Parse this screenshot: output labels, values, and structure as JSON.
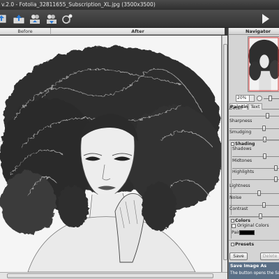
{
  "title": "v.2.0 - Fotolia_32811655_Subscription_XL.jpg (3500x3500)",
  "toolbar": {
    "icons": [
      "open-icon",
      "save-icon",
      "batch-icon",
      "batch-settings-icon",
      "effects-icon",
      "run-icon"
    ]
  },
  "view_tabs": {
    "before": "Before",
    "after": "After"
  },
  "navigator": {
    "title": "Navigator"
  },
  "zoom": {
    "value": "20%"
  },
  "panel_tabs": {
    "painting": "Painting",
    "text": "Text"
  },
  "sliders": {
    "detail": {
      "label": "Detail",
      "value": 0.78
    },
    "sharpness": {
      "label": "Sharpness",
      "value": 0.7
    },
    "smudging": {
      "label": "Smudging",
      "value": 0.72
    },
    "shadows": {
      "label": "Shadows",
      "value": 0.7
    },
    "midtones": {
      "label": "Midtones",
      "value": 0.95
    },
    "highlights": {
      "label": "Highlights",
      "value": 0.95
    },
    "lightness": {
      "label": "Lightness",
      "value": 0.6
    },
    "noise": {
      "label": "Noise",
      "value": 0.7
    },
    "contrast": {
      "label": "Contrast",
      "value": 0.62
    }
  },
  "groups": {
    "shading": "Shading",
    "colors": "Colors"
  },
  "colors": {
    "original_colors": "Original Colors",
    "paint": "Paint",
    "paint_color": "#000000"
  },
  "presets": {
    "title": "Presets",
    "save": "Save",
    "delete": "Delete"
  },
  "help": {
    "title": "Save Image As",
    "text": "The button opens the Save As"
  }
}
